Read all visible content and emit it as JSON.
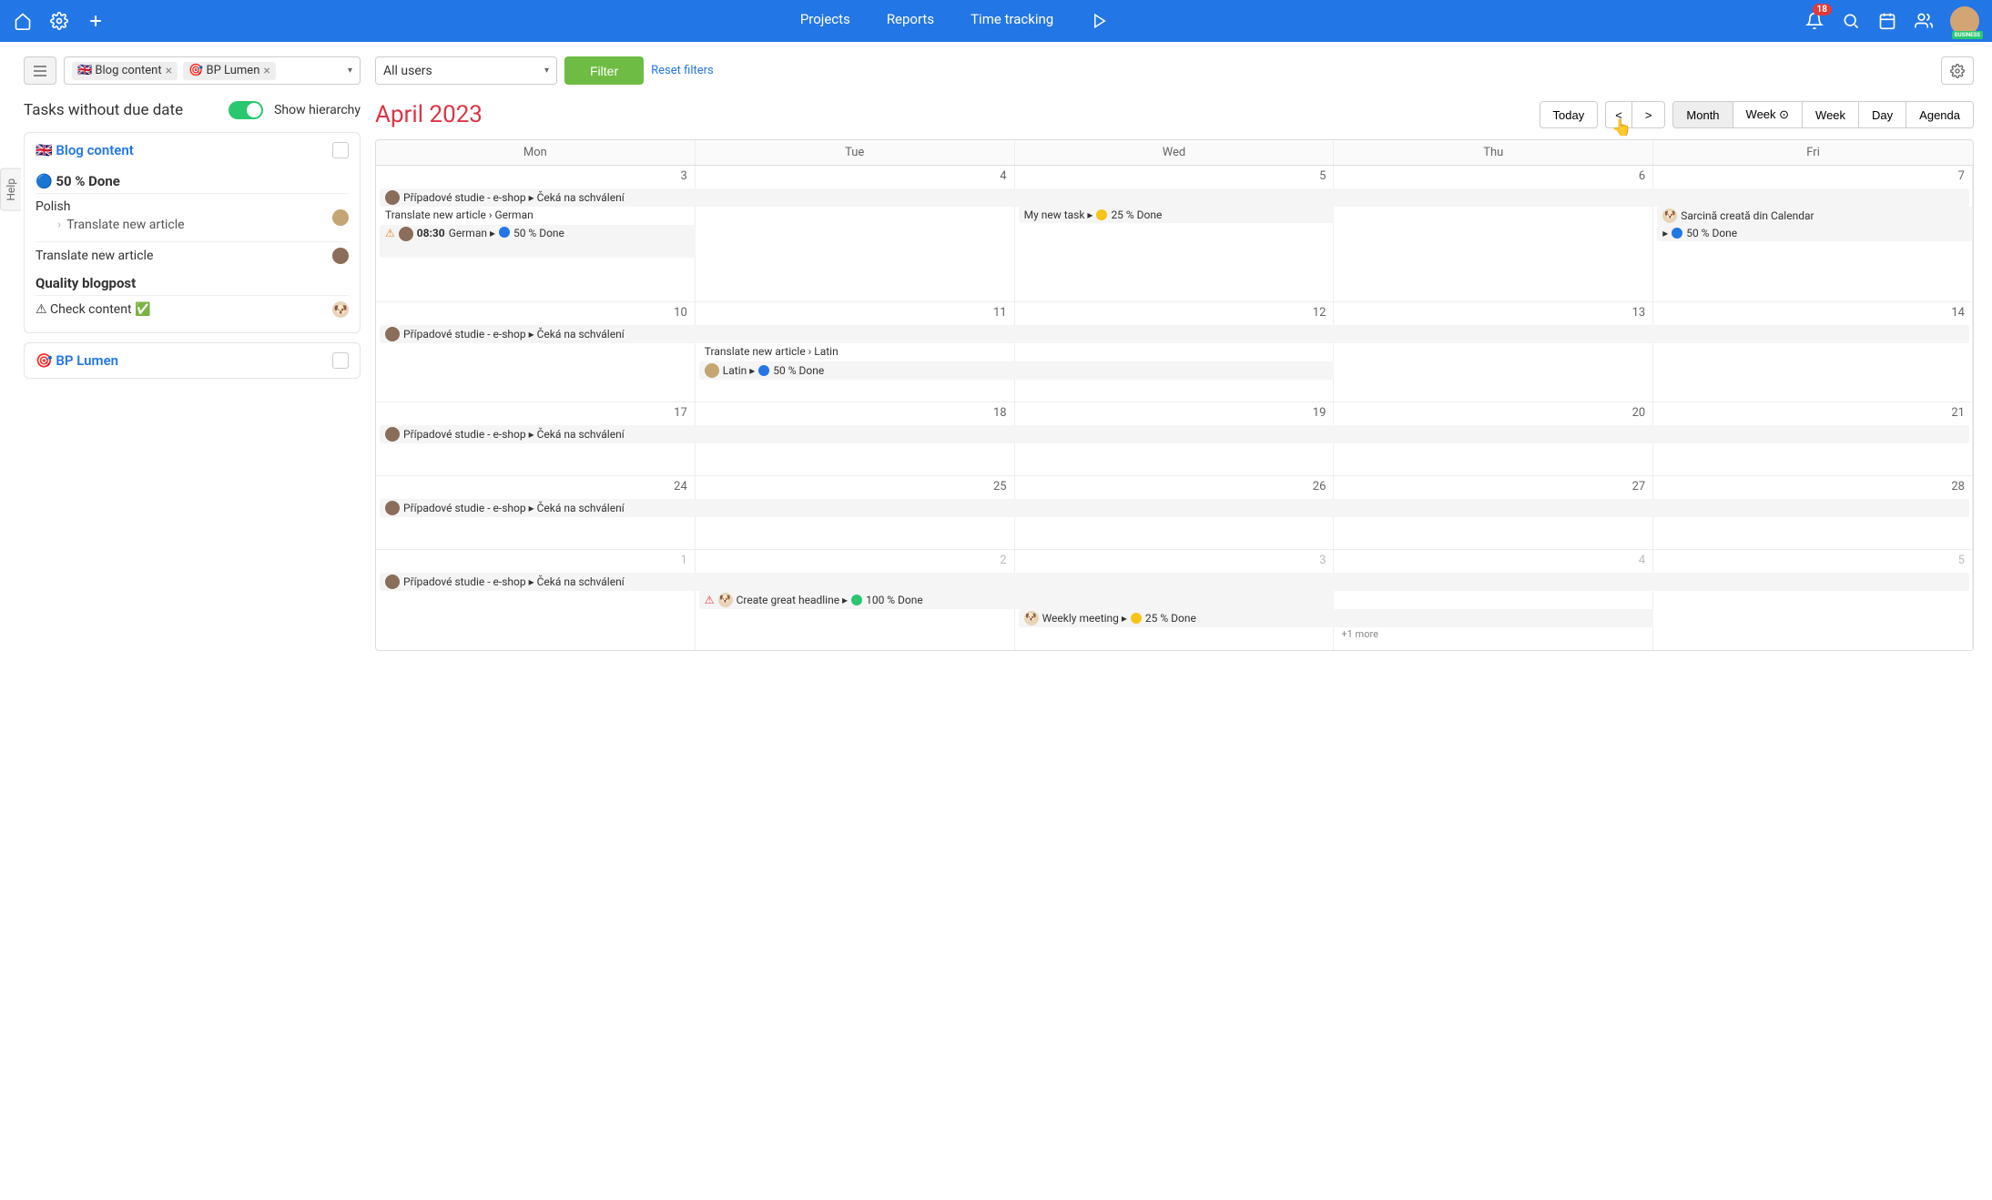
{
  "nav": {
    "projects": "Projects",
    "reports": "Reports",
    "time_tracking": "Time tracking",
    "notif_count": "18",
    "business_badge": "BUSINESS"
  },
  "help_tab": "Help",
  "filters": {
    "chip1": "🇬🇧 Blog content",
    "chip2": "🎯 BP Lumen",
    "all_users": "All users",
    "filter_btn": "Filter",
    "reset": "Reset filters"
  },
  "sidebar": {
    "title": "Tasks without due date",
    "show_hierarchy": "Show hierarchy",
    "groups": [
      {
        "title": "🇬🇧 Blog content",
        "sections": [
          {
            "heading": "🔵 50 % Done",
            "items": [
              {
                "label": "Polish",
                "sub": "Translate new article",
                "avatar": "a1"
              },
              {
                "label": "Translate new article",
                "avatar": "a2"
              }
            ]
          },
          {
            "heading": "Quality blogpost",
            "items": [
              {
                "label": "⚠ Check content ✅",
                "avatar": "dog"
              }
            ]
          }
        ]
      },
      {
        "title": "🎯 BP Lumen"
      }
    ]
  },
  "calendar": {
    "month_label": "April 2023",
    "today": "Today",
    "prev": "<",
    "next": ">",
    "views": [
      "Month",
      "Week ⊙",
      "Week",
      "Day",
      "Agenda"
    ],
    "active_view": "Month",
    "days": [
      "Mon",
      "Tue",
      "Wed",
      "Thu",
      "Fri"
    ],
    "weeks": [
      {
        "dates": [
          "3",
          "4",
          "5",
          "6",
          "7"
        ],
        "events": [
          {
            "type": "span5",
            "row": 1,
            "avatar": "a2",
            "text": "Případové studie - e-shop ▸ Čeká na schválení"
          },
          {
            "type": "cells",
            "col": 0,
            "row": 2,
            "text": "Translate new article › German",
            "plain": true
          },
          {
            "type": "cells",
            "col": 0,
            "row": 3,
            "warn": "orange",
            "avatar": "a2",
            "time": "08:30",
            "text": "German ▸",
            "dot": "blue",
            "status": "50 % Done",
            "wrap": true
          },
          {
            "type": "cells",
            "col": 2,
            "row": 2,
            "text": "My new task ▸",
            "dot": "yellow",
            "status": "25 % Done"
          },
          {
            "type": "cells",
            "col": 4,
            "row": 2,
            "avatar": "dog",
            "text": "Sarcină creată din Calendar"
          },
          {
            "type": "cells",
            "col": 4,
            "row": 3,
            "text": "▸",
            "dot": "blue",
            "status": "50 % Done"
          }
        ]
      },
      {
        "dates": [
          "10",
          "11",
          "12",
          "13",
          "14"
        ],
        "events": [
          {
            "type": "span5",
            "row": 1,
            "avatar": "a2",
            "text": "Případové studie - e-shop ▸ Čeká na schválení"
          },
          {
            "type": "cells",
            "col": 1,
            "row": 2,
            "text": "Translate new article › Latin",
            "plain": true,
            "wide": 2
          },
          {
            "type": "cells",
            "col": 1,
            "row": 3,
            "avatar": "a1",
            "text": "Latin ▸",
            "dot": "blue",
            "status": "50 % Done",
            "wide": 2
          }
        ]
      },
      {
        "dates": [
          "17",
          "18",
          "19",
          "20",
          "21"
        ],
        "events": [
          {
            "type": "span5",
            "row": 1,
            "avatar": "a2",
            "text": "Případové studie - e-shop ▸ Čeká na schválení"
          }
        ]
      },
      {
        "dates": [
          "24",
          "25",
          "26",
          "27",
          "28"
        ],
        "events": [
          {
            "type": "span5",
            "row": 1,
            "avatar": "a2",
            "text": "Případové studie - e-shop ▸ Čeká na schválení"
          }
        ]
      },
      {
        "dates": [
          "1",
          "2",
          "3",
          "4",
          "5"
        ],
        "muted": true,
        "events": [
          {
            "type": "span5",
            "row": 1,
            "avatar": "a2",
            "text": "Případové studie - e-shop ▸ Čeká na schválení"
          },
          {
            "type": "cells",
            "col": 1,
            "row": 2,
            "warn": "red",
            "avatar": "dog",
            "text": "Create great headline ▸",
            "dot": "green",
            "status": "100 % Done",
            "wide": 2
          },
          {
            "type": "cells",
            "col": 2,
            "row": 3,
            "avatar": "dog",
            "text": "Weekly meeting ▸",
            "dot": "yellow",
            "status": "25 % Done",
            "wide": 2
          },
          {
            "type": "more",
            "col": 3,
            "row": 4,
            "text": "+1 more"
          }
        ]
      }
    ]
  }
}
